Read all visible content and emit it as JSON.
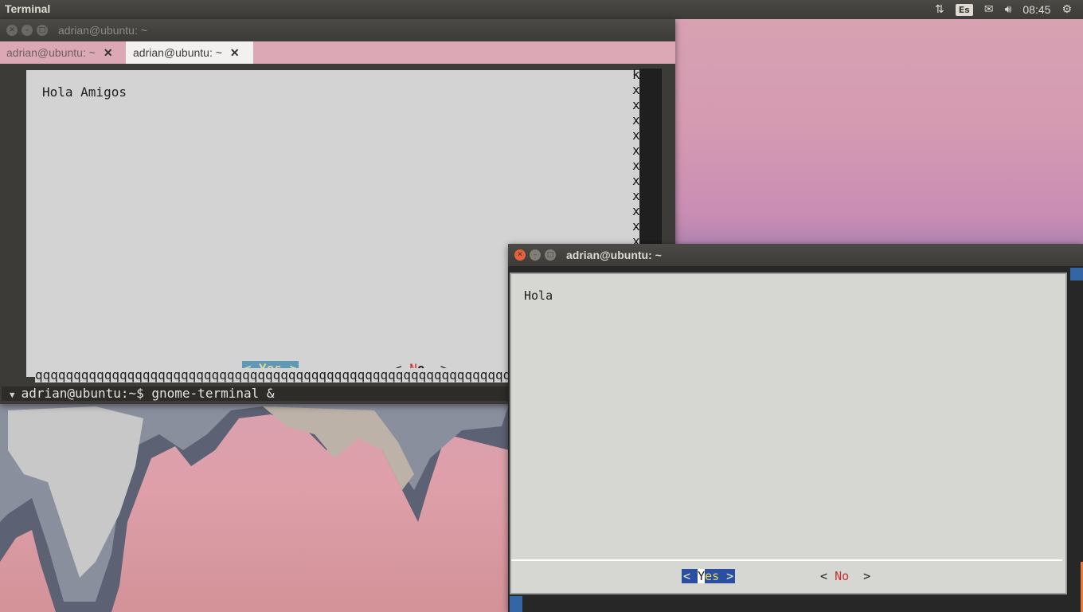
{
  "top_panel": {
    "app_title": "Terminal",
    "keyboard_layout": "Es",
    "clock": "08:45",
    "icons": [
      "network-icon",
      "keyboard-layout-icon",
      "mail-icon",
      "volume-icon",
      "clock-text",
      "gear-icon"
    ]
  },
  "window1": {
    "title": "adrian@ubuntu: ~",
    "tabs": [
      {
        "label": "adrian@ubuntu: ~",
        "close": "✕"
      },
      {
        "label": "adrian@ubuntu: ~",
        "close": "✕"
      }
    ],
    "dialog": {
      "message": "Hola Amigos",
      "border_top": "k",
      "border_side": "x",
      "yes_button": "< Yes >",
      "no_left": "< ",
      "no_hot": "N",
      "no_rest": "o",
      "no_right": "  >",
      "bottom_line": "qqqqqqqqqqqqqqqqqqqqqqqqqqqqqqqqqqqqqqqqqqqqqqqqqqqqqqqqqqqqqqqqqqqqqqqqqqqqqq"
    },
    "prompt": {
      "arrow": "▼",
      "text": "adrian@ubuntu:~$ gnome-terminal &"
    }
  },
  "window2": {
    "title": "adrian@ubuntu: ~",
    "dialog": {
      "message": "Hola",
      "yes_left": "< ",
      "yes_cursor": "Y",
      "yes_hot": "es",
      "yes_right": " >",
      "no_left": "< ",
      "no_hot": "No",
      "no_right": "  >"
    }
  },
  "colors": {
    "panel": "#3c3b37",
    "close_button": "#e8603c",
    "selected_button": "#2a4fa0",
    "accent_yes1": "#5e9ab6"
  }
}
